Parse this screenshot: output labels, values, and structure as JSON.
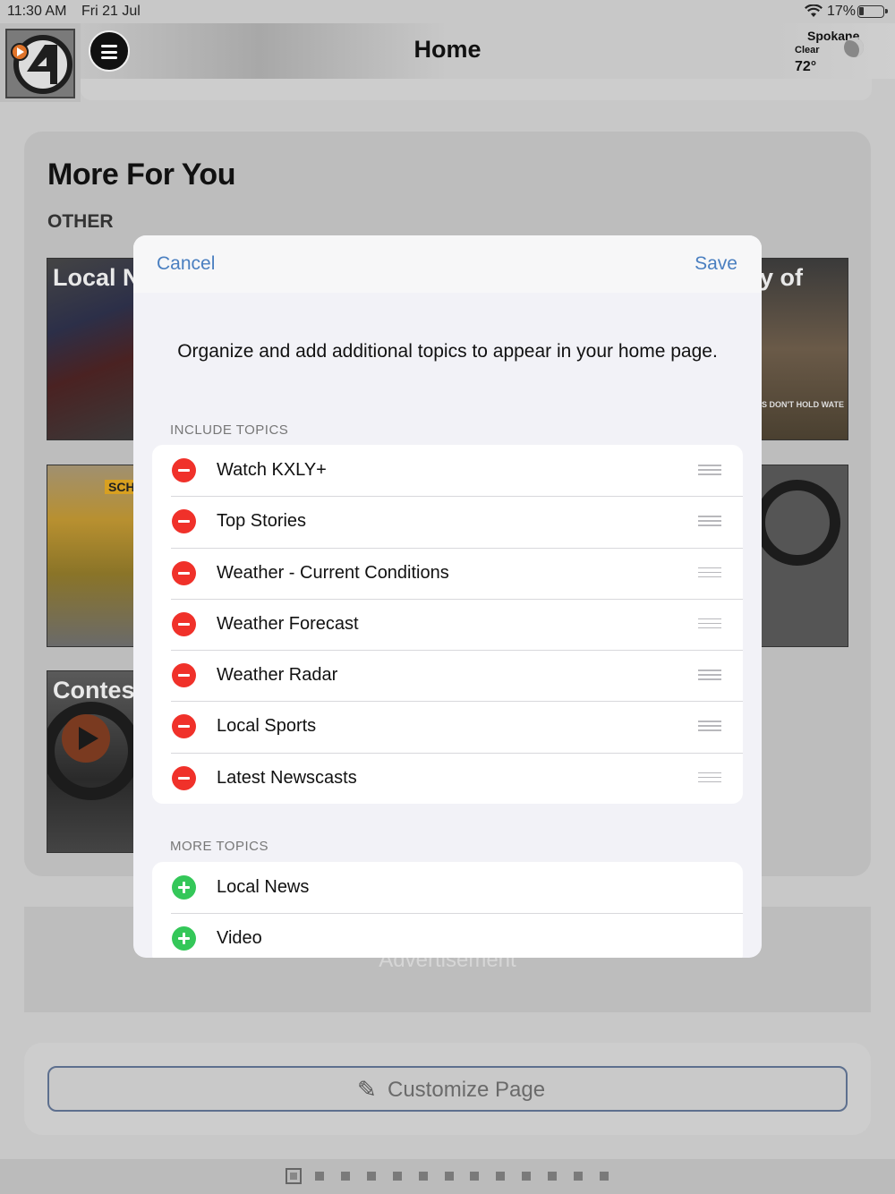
{
  "status_bar": {
    "time": "11:30 AM",
    "date": "Fri 21 Jul",
    "battery": "17%",
    "wifi_icon": "wifi-icon"
  },
  "header": {
    "title": "Home",
    "weather": {
      "city": "Spokane",
      "condition": "Clear",
      "temperature": "72°"
    }
  },
  "background": {
    "section_title": "More For You",
    "section_subtitle": "OTHER",
    "tiles": [
      {
        "label": "Local Ne"
      },
      {
        "label": "SCHO"
      },
      {
        "label": "Contests"
      },
      {
        "label": "y of",
        "caption": "S DON'T HOLD WATE"
      },
      {
        "label": ""
      }
    ],
    "advertisement": "Advertisement",
    "customize_button": "Customize Page"
  },
  "pager": {
    "page_count": 13,
    "current_page": 1
  },
  "modal": {
    "cancel_label": "Cancel",
    "save_label": "Save",
    "description": "Organize and add additional topics to appear in your home page.",
    "include_header": "INCLUDE TOPICS",
    "include_topics": [
      "Watch KXLY+",
      "Top Stories",
      "Weather - Current Conditions",
      "Weather Forecast",
      "Weather Radar",
      "Local Sports",
      "Latest Newscasts"
    ],
    "more_header": "MORE TOPICS",
    "more_topics": [
      "Local News",
      "Video"
    ]
  }
}
